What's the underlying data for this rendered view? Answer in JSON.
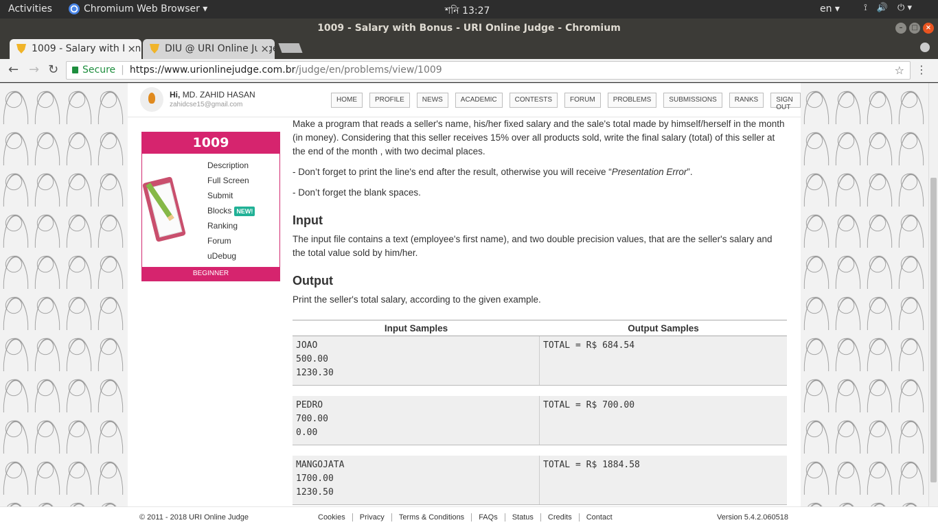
{
  "os": {
    "activities": "Activities",
    "app_name": "Chromium Web Browser ▾",
    "clock": "শনি  13:27",
    "lang": "en ▾",
    "tray": [
      "⟟",
      "🔊",
      "⏻ ▾"
    ]
  },
  "window": {
    "title": "1009 - Salary with Bonus - URI Online Judge - Chromium"
  },
  "tabs": [
    {
      "label": "1009 - Salary with Bonus",
      "close": "×"
    },
    {
      "label": "DIU @ URI Online Judge",
      "close": "×"
    }
  ],
  "address": {
    "secure_label": "Secure",
    "url_scheme_host": "https://www.urionlinejudge.com.br",
    "url_path": "/judge/en/problems/view/1009"
  },
  "user": {
    "greeting": "Hi,",
    "name": "MD. ZAHID HASAN",
    "email": "zahidcse15@gmail.com"
  },
  "nav": [
    "HOME",
    "PROFILE",
    "NEWS",
    "ACADEMIC",
    "CONTESTS",
    "FORUM",
    "PROBLEMS",
    "SUBMISSIONS",
    "RANKS",
    "SIGN OUT"
  ],
  "problem": {
    "number": "1009",
    "menu": [
      "Description",
      "Full Screen",
      "Submit",
      "Blocks",
      "Ranking",
      "Forum",
      "uDebug"
    ],
    "new_badge": "NEW!",
    "level": "BEGINNER"
  },
  "statement": {
    "p1": "Make a program that reads a seller's name, his/her fixed salary and the sale's total made by himself/herself in the month (in money). Considering that this seller receives 15% over all products sold, write the final salary (total) of this seller at the end of the month , with two decimal places.",
    "p2_before": "- Don’t forget to print the line's end after the result, otherwise you will receive “",
    "p2_em": "Presentation Error",
    "p2_after": "”.",
    "p3": "- Don’t forget the blank spaces.",
    "input_title": "Input",
    "input_text": "The input file contains a text (employee's first name), and two double precision values, that are the seller's salary and the total value sold by him/her.",
    "output_title": "Output",
    "output_text": "Print the seller's total salary, according to the given example."
  },
  "samples": {
    "input_header": "Input Samples",
    "output_header": "Output Samples",
    "rows": [
      {
        "in": [
          "JOAO",
          "500.00",
          "1230.30"
        ],
        "out": "TOTAL = R$ 684.54"
      },
      {
        "in": [
          "PEDRO",
          "700.00",
          "0.00"
        ],
        "out": "TOTAL = R$ 700.00"
      },
      {
        "in": [
          "MANGOJATA",
          "1700.00",
          "1230.50"
        ],
        "out": "TOTAL = R$ 1884.58"
      }
    ]
  },
  "footer": {
    "copyright": "© 2011 - 2018 URI Online Judge",
    "links": [
      "Cookies",
      "Privacy",
      "Terms & Conditions",
      "FAQs",
      "Status",
      "Credits",
      "Contact"
    ],
    "version": "Version 5.4.2.060518"
  }
}
